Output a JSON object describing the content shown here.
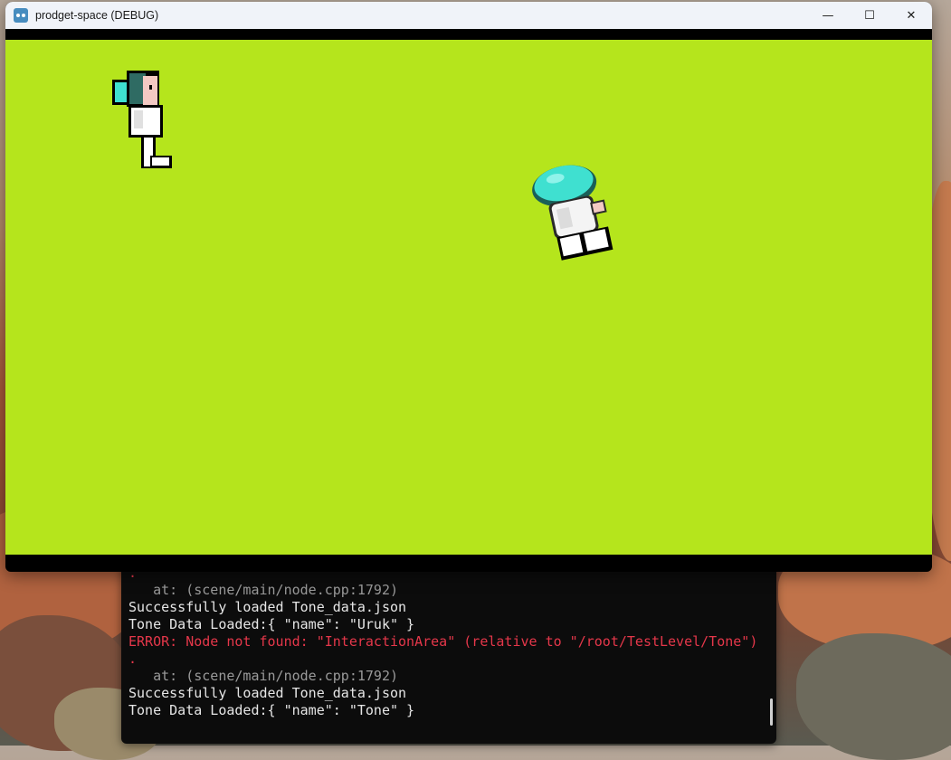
{
  "window": {
    "title": "prodget-space (DEBUG)",
    "controls": {
      "minimize": "—",
      "maximize": "☐",
      "close": "✕"
    },
    "viewport_color": "#b5e51c"
  },
  "terminal": {
    "lines": [
      {
        "text": ".",
        "style": "err"
      },
      {
        "text": "   at: (scene/main/node.cpp:1792)",
        "style": "dim"
      },
      {
        "text": "Successfully loaded Tone_data.json",
        "style": "normal"
      },
      {
        "text": "Tone Data Loaded:{ \"name\": \"Uruk\" }",
        "style": "normal"
      },
      {
        "text": "ERROR: Node not found: \"InteractionArea\" (relative to \"/root/TestLevel/Tone\")",
        "style": "err"
      },
      {
        "text": ".",
        "style": "err"
      },
      {
        "text": "   at: (scene/main/node.cpp:1792)",
        "style": "dim"
      },
      {
        "text": "Successfully loaded Tone_data.json",
        "style": "normal"
      },
      {
        "text": "Tone Data Loaded:{ \"name\": \"Tone\" }",
        "style": "normal"
      }
    ]
  },
  "characters": [
    {
      "name": "astronaut-girl-sprite"
    },
    {
      "name": "astronaut-tumbling-sprite"
    }
  ]
}
